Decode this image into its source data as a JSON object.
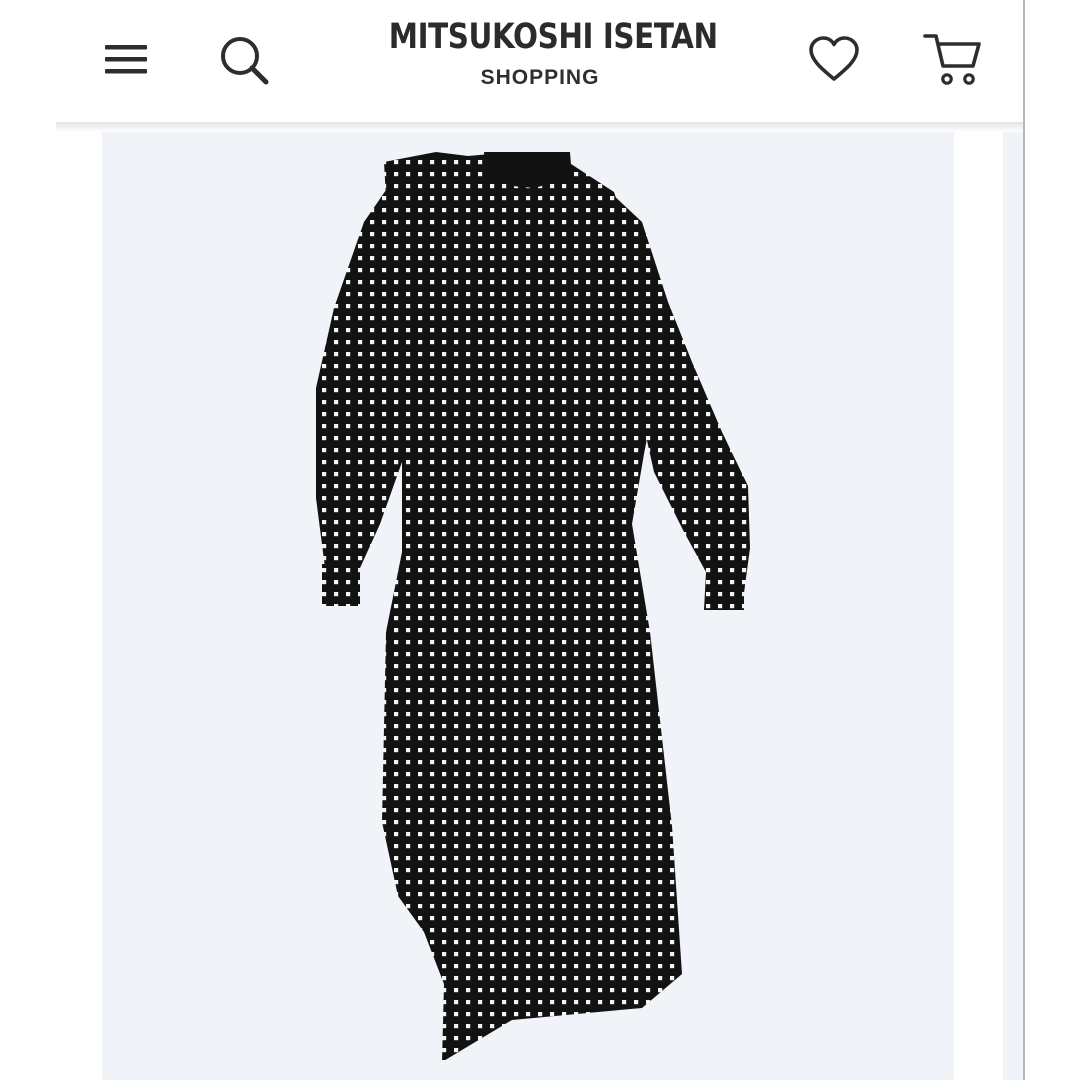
{
  "header": {
    "brand_name": "MITSUKOSHI ISETAN",
    "brand_sub": "SHOPPING",
    "icons": {
      "menu": "hamburger-menu-icon",
      "search": "search-icon",
      "wishlist": "heart-icon",
      "cart": "cart-icon"
    }
  },
  "product": {
    "image": "black dress with white square dots"
  },
  "colors": {
    "gallery_background": "#f0f4f8",
    "icon": "#2d2d2d",
    "dress": "#121212",
    "dots": "#f4f4f4"
  }
}
